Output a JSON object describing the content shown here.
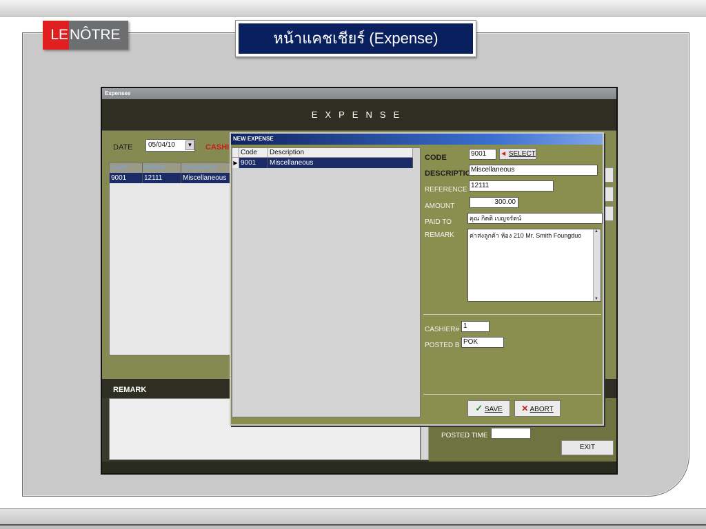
{
  "slide": {
    "logo_left": "LE",
    "logo_right": "NÔTRE",
    "title": "หน้าแคชเชียร์ (Expense)"
  },
  "app": {
    "window_title": "Expenses",
    "header": "EXPENSE",
    "date_label": "DATE",
    "date_value": "05/04/10",
    "cashier_label": "CASHI",
    "grid": {
      "columns": [
        "Code",
        "Refer#",
        "Description"
      ],
      "rows": [
        {
          "code": "9001",
          "refer": "12111",
          "description": "Miscellaneous"
        }
      ]
    },
    "remark_label": "REMARK",
    "posted_time_label": "POSTED TIME",
    "posted_time_value": "",
    "exit_label": "EXIT"
  },
  "dialog": {
    "title": "NEW EXPENSE",
    "list": {
      "columns": [
        "Code",
        "Description"
      ],
      "rows": [
        {
          "code": "9001",
          "description": "Miscellaneous"
        }
      ]
    },
    "fields": {
      "code_label": "CODE",
      "code_value": "9001",
      "select_label": "SELECT",
      "description_label": "DESCRIPTIC",
      "description_value": "Miscellaneous",
      "reference_label": "REFERENCE",
      "reference_value": "12111",
      "amount_label": "AMOUNT",
      "amount_value": "300.00",
      "paid_to_label": "PAID TO",
      "paid_to_value": "คุณ กิตติ เบญจรัตน์",
      "remark_label": "REMARK",
      "remark_value": "ค่าส่งลูกค้า ห้อง 210 Mr. Smith Foungduo",
      "cashier_label": "CASHIER#",
      "cashier_value": "1",
      "posted_by_label": "POSTED B",
      "posted_by_value": "POK"
    },
    "save_label": "SAVE",
    "abort_label": "ABORT"
  },
  "colors": {
    "title_bg": "#0a1f5e",
    "logo_red": "#e0201f",
    "logo_gray": "#6d6e70",
    "app_olive": "#858a52",
    "selection": "#1b2b66"
  }
}
